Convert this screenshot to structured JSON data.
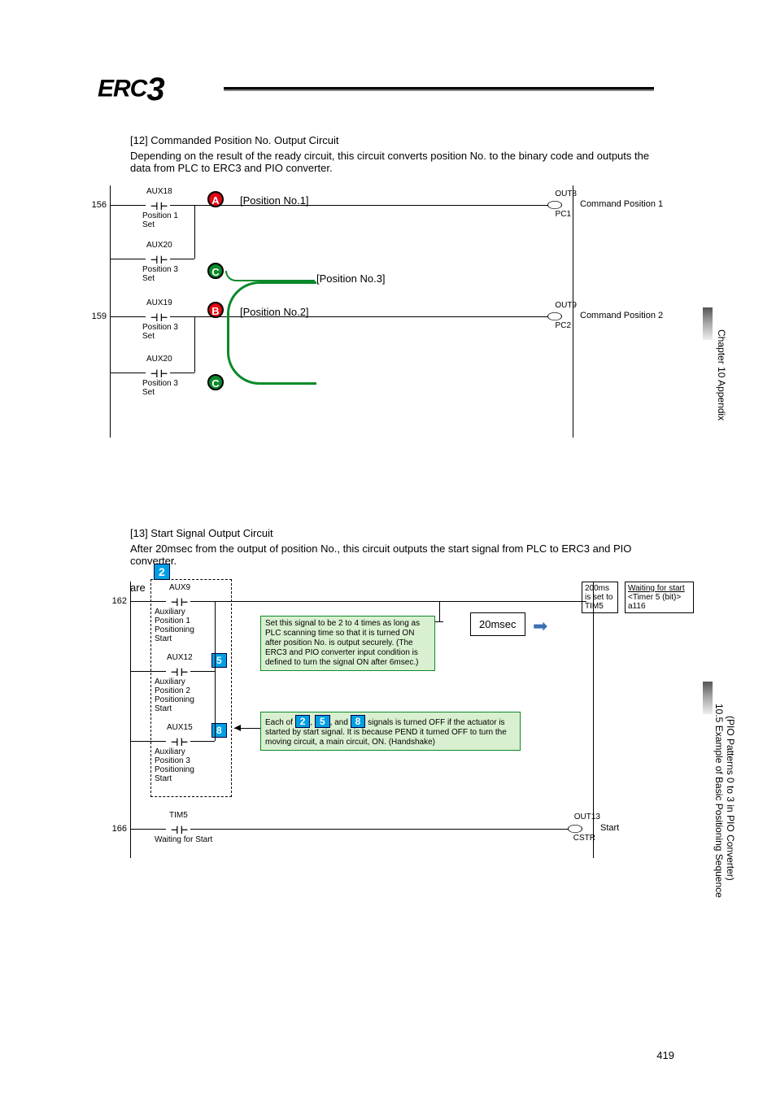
{
  "logo": {
    "brand": "ERC",
    "num": "3"
  },
  "section12": {
    "head": "[12] Commanded Position No. Output Circuit",
    "desc": "Depending on the result of the ready circuit, this circuit converts position No. to the binary code and outputs the data from PLC to ERC3 and PIO converter."
  },
  "ladder1": {
    "rung1_num": "156",
    "rung2_num": "159",
    "aux18": "AUX18",
    "aux18_lbl": "Position 1\nSet",
    "aux20a": "AUX20",
    "aux20a_lbl": "Position 3\nSet",
    "aux19": "AUX19",
    "aux19_lbl": "Position 3\nSet",
    "aux20b": "AUX20",
    "aux20b_lbl": "Position 3\nSet",
    "out8": "OUT8",
    "pc1": "PC1",
    "cp1": "Command Position 1",
    "out9": "OUT9",
    "pc2": "PC2",
    "cp2": "Command Position 2",
    "badgeA": "A",
    "badgeB": "B",
    "badgeC": "C",
    "pos1": "[Position No.1]",
    "pos2": "[Position No.2]",
    "pos3": "[Position No.3]"
  },
  "section13": {
    "head": "[13] Start Signal Output Circuit",
    "desc": "After 20msec from the output of position No., this circuit outputs the start signal from PLC to ERC3 and PIO converter."
  },
  "ladder2": {
    "rnum162": "162",
    "rnum166": "166",
    "aux9": "AUX9",
    "aux9_lbl": "Auxiliary\nPosition 1\nPositioning\nStart",
    "aux12": "AUX12",
    "aux12_lbl": "Auxiliary\nPosition 2\nPositioning\nStart",
    "aux15": "AUX15",
    "aux15_lbl": "Auxiliary\nPosition 3\nPositioning\nStart",
    "tim5": "TIM5",
    "tim5_lbl": "Waiting for Start",
    "note1": "Set this signal to be 2 to 4 times as long as PLC scanning time so that it is turned ON after position No. is output securely. (The ERC3 and PIO converter input condition is defined to turn the signal ON after 6msec.)",
    "note2a": "Each of ",
    "note2b": " signals is turned OFF if the actuator is started by start signal. It is because PEND it turned OFF to turn the moving circuit, a main circuit, ON. (Handshake)",
    "and_word": ", and ",
    "sep": ", ",
    "timer20": "20msec",
    "box200a": "200ms",
    "box200b": "is set to",
    "box200c": "TIM5",
    "boxwait1": "Waiting for start",
    "boxwait2": "<Timer 5 (bit)>",
    "boxwait3": "a116",
    "out13": "OUT13",
    "cstr": "CSTR",
    "start": "Start",
    "sq2": "2",
    "sq5": "5",
    "sq8": "8"
  },
  "sidebar": {
    "chapter": "Chapter 10 Appendix",
    "section_a": "10.5 Example of Basic Positioning Sequence",
    "section_b": "(PIO Patterns 0 to 3 in PIO Converter)"
  },
  "page_number": "419"
}
